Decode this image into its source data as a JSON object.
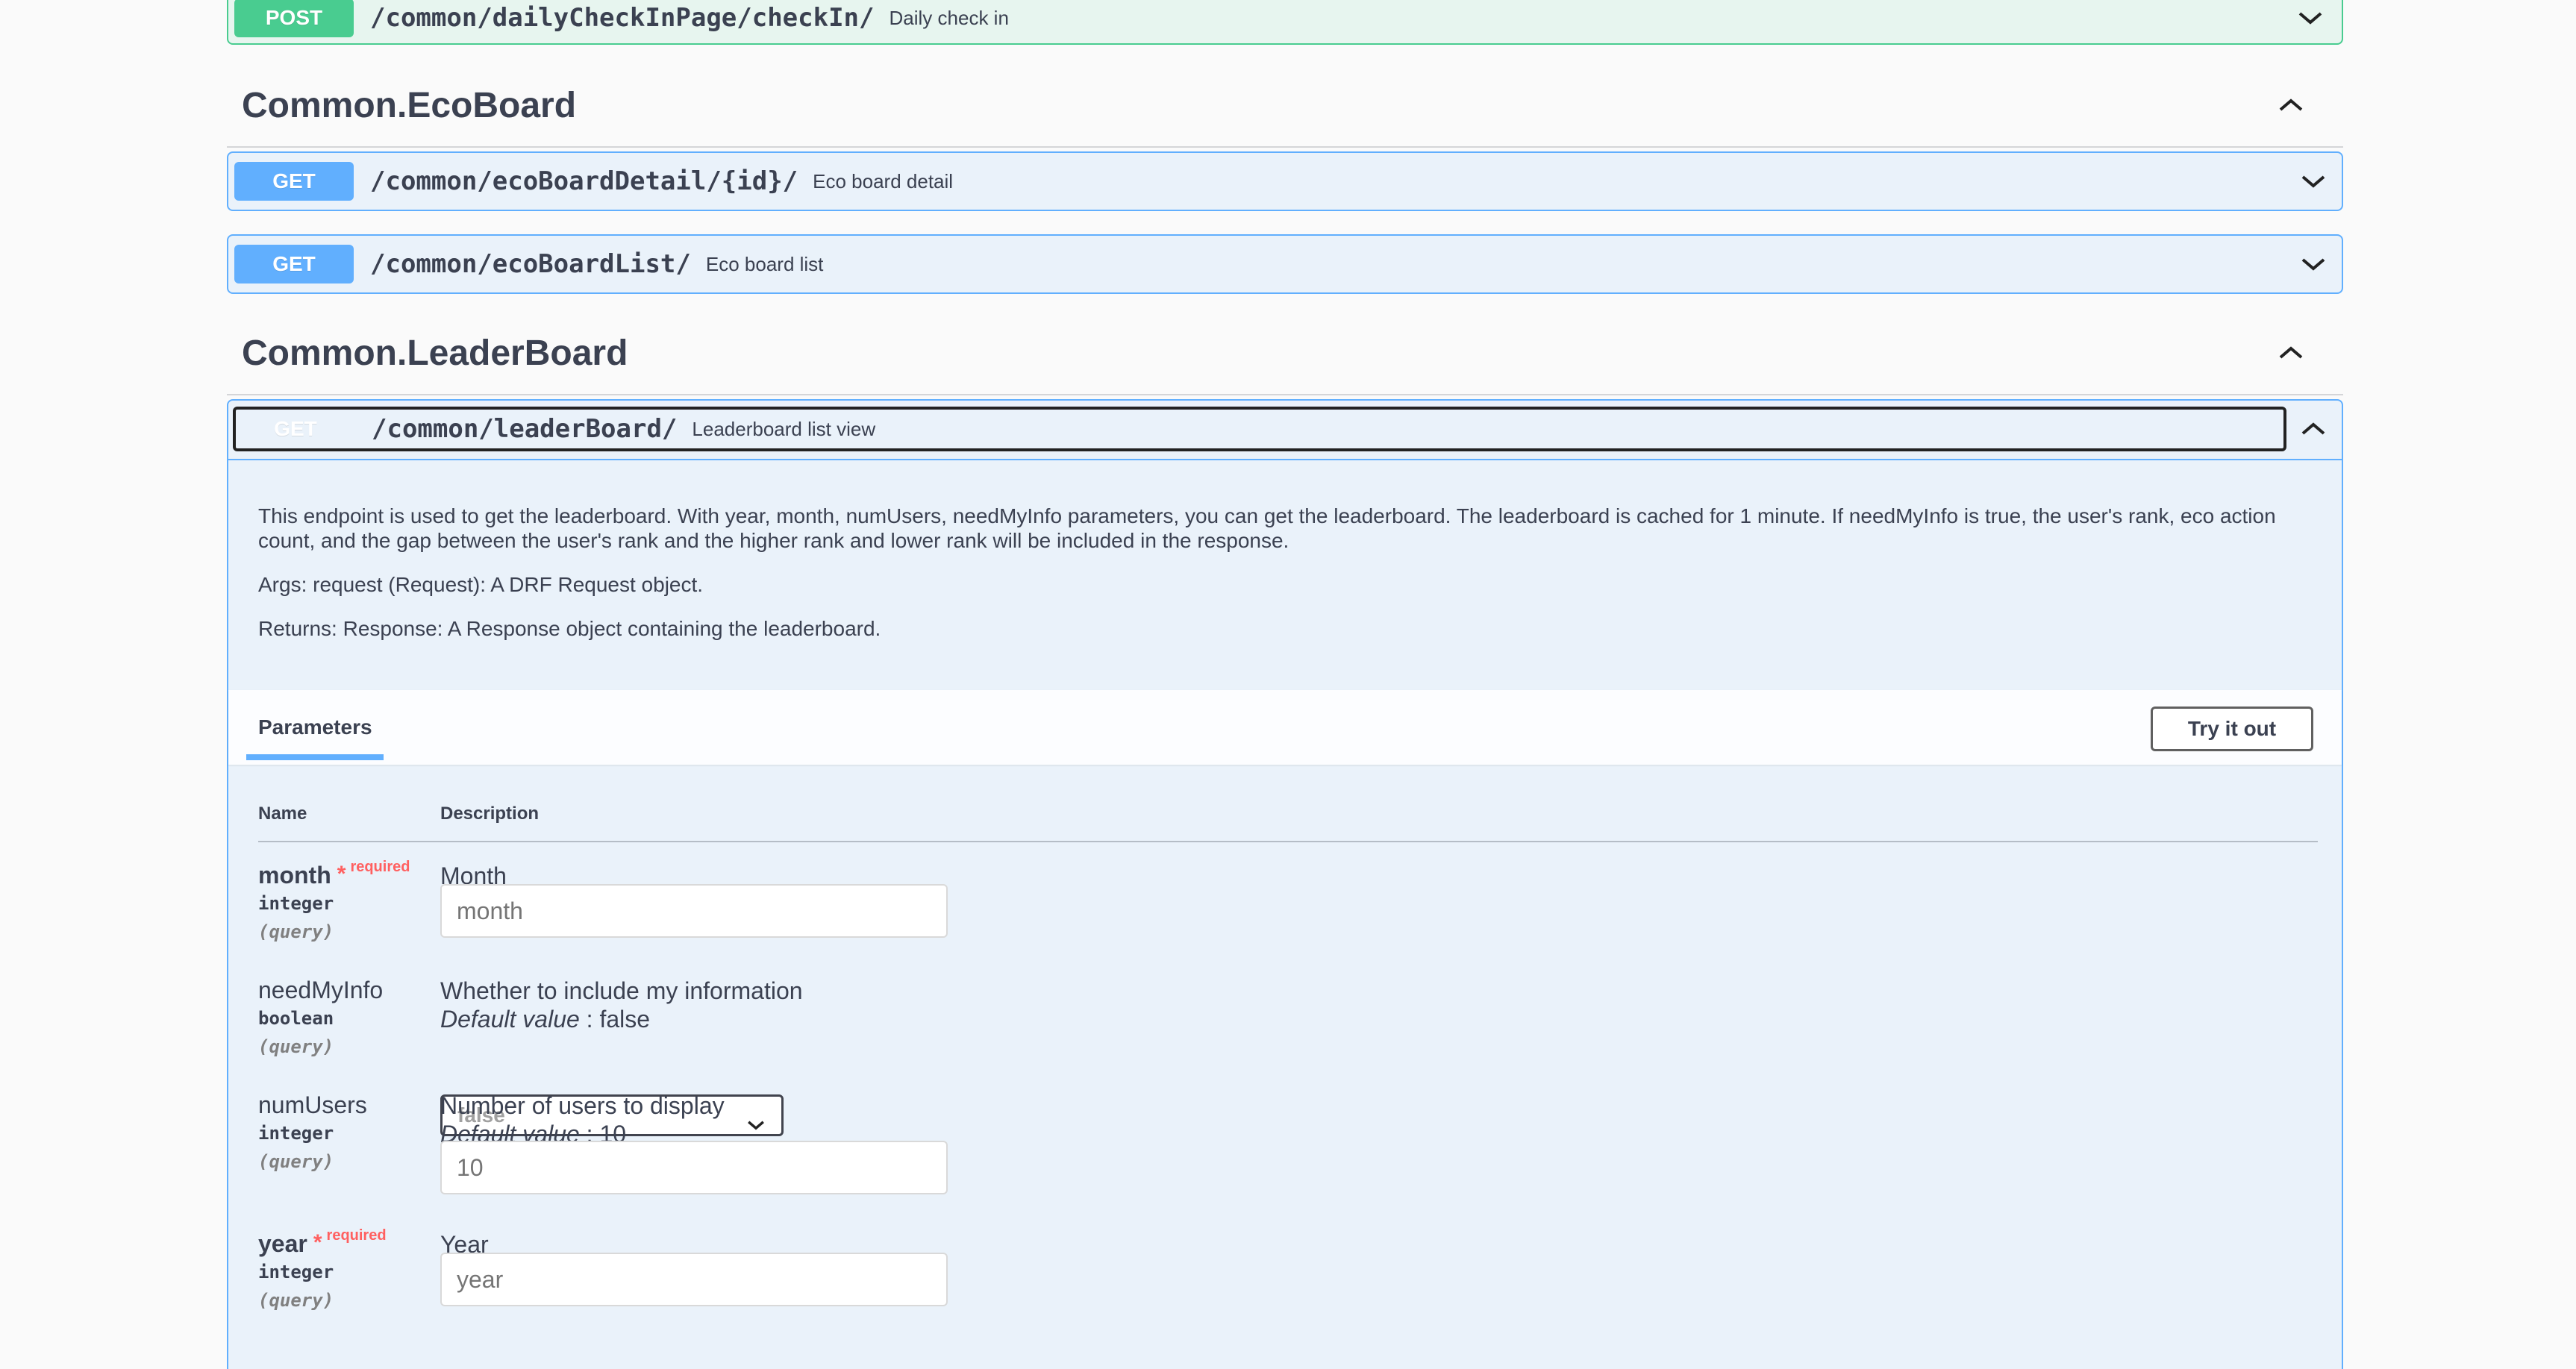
{
  "sections": {
    "daily": {
      "method": "POST",
      "path": "/common/dailyCheckInPage/checkIn/",
      "summary": "Daily check in"
    },
    "ecoboard": {
      "title": "Common.EcoBoard",
      "ops": [
        {
          "method": "GET",
          "path": "/common/ecoBoardDetail/{id}/",
          "summary": "Eco board detail"
        },
        {
          "method": "GET",
          "path": "/common/ecoBoardList/",
          "summary": "Eco board list"
        }
      ]
    },
    "leaderboard": {
      "title": "Common.LeaderBoard",
      "op": {
        "method": "GET",
        "path": "/common/leaderBoard/",
        "summary": "Leaderboard list view",
        "description": [
          "This endpoint is used to get the leaderboard. With year, month, numUsers, needMyInfo parameters, you can get the leaderboard. The leaderboard is cached for 1 minute. If needMyInfo is true, the user's rank, eco action count, and the gap between the user's rank and the higher rank and lower rank will be included in the response.",
          "Args: request (Request): A DRF Request object.",
          "Returns: Response: A Response object containing the leaderboard."
        ],
        "params_tab": "Parameters",
        "try_button": "Try it out",
        "columns": {
          "name": "Name",
          "description": "Description"
        },
        "params": [
          {
            "name": "month",
            "required": true,
            "required_label": "required",
            "star": "*",
            "type": "integer",
            "in": "(query)",
            "description": "Month",
            "default_label": "",
            "default_value": "",
            "placeholder": "month"
          },
          {
            "name": "needMyInfo",
            "required": false,
            "type": "boolean",
            "in": "(query)",
            "description": "Whether to include my information",
            "default_label": "Default value",
            "default_value": " : false",
            "select_value": "false"
          },
          {
            "name": "numUsers",
            "required": false,
            "type": "integer",
            "in": "(query)",
            "description": "Number of users to display",
            "default_label": "Default value",
            "default_value": " : 10",
            "placeholder": "10"
          },
          {
            "name": "year",
            "required": true,
            "required_label": "required",
            "star": "*",
            "type": "integer",
            "in": "(query)",
            "description": "Year",
            "default_label": "",
            "default_value": "",
            "placeholder": "year"
          }
        ]
      }
    }
  },
  "icons": {
    "collapse": "chevron-up-icon",
    "expand": "chevron-down-icon"
  },
  "colors": {
    "get": "#61affe",
    "post": "#49cc90",
    "required": "#ff6060"
  }
}
